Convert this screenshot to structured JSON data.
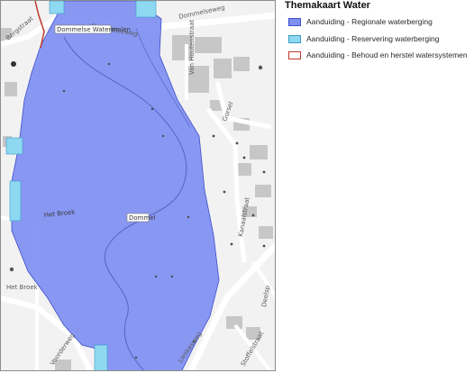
{
  "legend": {
    "title": "Themakaart Water",
    "items": [
      {
        "label": "Aanduiding - Regionale waterberging",
        "fill": "#7f8ff2",
        "border": "#3f4fc9"
      },
      {
        "label": "Aanduiding - Reservering waterberging",
        "fill": "#8fd8f2",
        "border": "#3a9cc6"
      },
      {
        "label": "Aanduiding - Behoud en herstel watersystemen",
        "fill": "#ffffff",
        "border": "#c0392b"
      }
    ]
  },
  "map": {
    "colors": {
      "regional": "#7f8ff2",
      "reservation": "#8fd8f2",
      "water_system": "#c0392b",
      "background": "#f2f2f2",
      "building": "#c7c7c7",
      "road": "#ffffff"
    },
    "labels": {
      "dommelseweg_1": "Dommelseweg",
      "dommelseweg_2": "Dommelseweg",
      "dommelse_watermolen": "Dommelse Watermolen",
      "het_broek_1": "Het Broek",
      "het_broek_2": "Het Broek",
      "dommel": "Dommel",
      "kanaalstraat": "Kanaalstraat",
      "vanhoutenstraat": "Van\nHoutenstraat",
      "gorsel": "Gorsel",
      "bergstraat": "Bergstraat",
      "voorderweg": "Voorderweg",
      "lieskesweg": "Lieskesweg",
      "stoffelstraat": "Stoffelstraat",
      "deelsp": "Deelsp"
    }
  }
}
